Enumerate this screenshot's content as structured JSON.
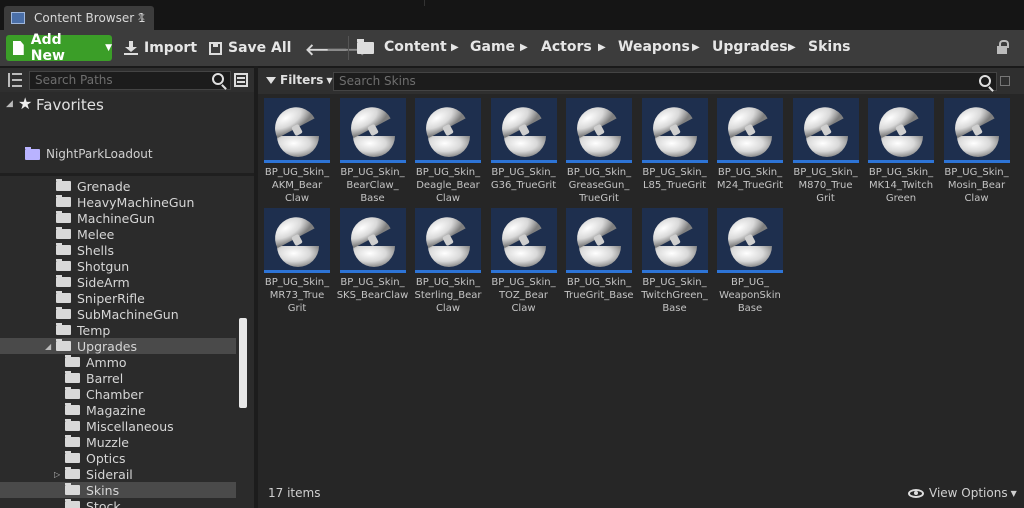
{
  "tab": {
    "label": "Content Browser 1",
    "close": "✕"
  },
  "toolbar": {
    "add_new": "Add New",
    "import": "Import",
    "save_all": "Save All",
    "back": "🡐",
    "forward": "🡒"
  },
  "breadcrumbs": [
    "Content",
    "Game",
    "Actors",
    "Weapons",
    "Upgrades",
    "Skins"
  ],
  "sources": {
    "search_placeholder": "Search Paths",
    "favorites_title": "Favorites",
    "favorites": [
      "NightParkLoadout"
    ],
    "tree": [
      {
        "label": "Grenade",
        "depth": 0
      },
      {
        "label": "HeavyMachineGun",
        "depth": 0
      },
      {
        "label": "MachineGun",
        "depth": 0
      },
      {
        "label": "Melee",
        "depth": 0
      },
      {
        "label": "Shells",
        "depth": 0
      },
      {
        "label": "Shotgun",
        "depth": 0
      },
      {
        "label": "SideArm",
        "depth": 0
      },
      {
        "label": "SniperRifle",
        "depth": 0
      },
      {
        "label": "SubMachineGun",
        "depth": 0
      },
      {
        "label": "Temp",
        "depth": 0
      },
      {
        "label": "Upgrades",
        "depth": 0,
        "expanded": true
      },
      {
        "label": "Ammo",
        "depth": 1
      },
      {
        "label": "Barrel",
        "depth": 1
      },
      {
        "label": "Chamber",
        "depth": 1
      },
      {
        "label": "Magazine",
        "depth": 1
      },
      {
        "label": "Miscellaneous",
        "depth": 1
      },
      {
        "label": "Muzzle",
        "depth": 1
      },
      {
        "label": "Optics",
        "depth": 1
      },
      {
        "label": "Siderail",
        "depth": 1,
        "collapsed": true
      },
      {
        "label": "Skins",
        "depth": 1,
        "selected": true
      },
      {
        "label": "Stock",
        "depth": 1
      }
    ]
  },
  "assets": {
    "filters_label": "Filters",
    "search_placeholder": "Search Skins",
    "items": [
      "BP_UG_Skin_AKM_BearClaw",
      "BP_UG_Skin_BearClaw_Base",
      "BP_UG_Skin_Deagle_BearClaw",
      "BP_UG_Skin_G36_TrueGrit",
      "BP_UG_Skin_GreaseGun_TrueGrit",
      "BP_UG_Skin_L85_TrueGrit",
      "BP_UG_Skin_M24_TrueGrit",
      "BP_UG_Skin_M870_TrueGrit",
      "BP_UG_Skin_MK14_TwitchGreen",
      "BP_UG_Skin_Mosin_BearClaw",
      "BP_UG_Skin_MR73_TrueGrit",
      "BP_UG_Skin_SKS_BearClaw",
      "BP_UG_Skin_Sterling_BearClaw",
      "BP_UG_Skin_TOZ_BearClaw",
      "BP_UG_Skin_TrueGrit_Base",
      "BP_UG_Skin_TwitchGreen_Base",
      "BP_UG_WeaponSkinBase"
    ],
    "display_labels": [
      [
        "BP_UG_Skin_",
        "AKM_Bear",
        "Claw"
      ],
      [
        "BP_UG_Skin_",
        "BearClaw_",
        "Base"
      ],
      [
        "BP_UG_Skin_",
        "Deagle_Bear",
        "Claw"
      ],
      [
        "BP_UG_Skin_",
        "G36_TrueGrit"
      ],
      [
        "BP_UG_Skin_",
        "GreaseGun_",
        "TrueGrit"
      ],
      [
        "BP_UG_Skin_",
        "L85_TrueGrit"
      ],
      [
        "BP_UG_Skin_",
        "M24_TrueGrit"
      ],
      [
        "BP_UG_Skin_",
        "M870_True",
        "Grit"
      ],
      [
        "BP_UG_Skin_",
        "MK14_Twitch",
        "Green"
      ],
      [
        "BP_UG_Skin_",
        "Mosin_Bear",
        "Claw"
      ],
      [
        "BP_UG_Skin_",
        "MR73_True",
        "Grit"
      ],
      [
        "BP_UG_Skin_",
        "SKS_BearClaw"
      ],
      [
        "BP_UG_Skin_",
        "Sterling_Bear",
        "Claw"
      ],
      [
        "BP_UG_Skin_",
        "TOZ_Bear",
        "Claw"
      ],
      [
        "BP_UG_Skin_",
        "TrueGrit_Base"
      ],
      [
        "BP_UG_Skin_",
        "TwitchGreen_",
        "Base"
      ],
      [
        "BP_UG_",
        "WeaponSkin",
        "Base"
      ]
    ],
    "item_count": "17 items",
    "view_options": "View Options"
  },
  "colors": {
    "accent_green": "#3b9e28",
    "thumb_bg": "#1e2f4e",
    "thumb_underline": "#2d74d6"
  }
}
